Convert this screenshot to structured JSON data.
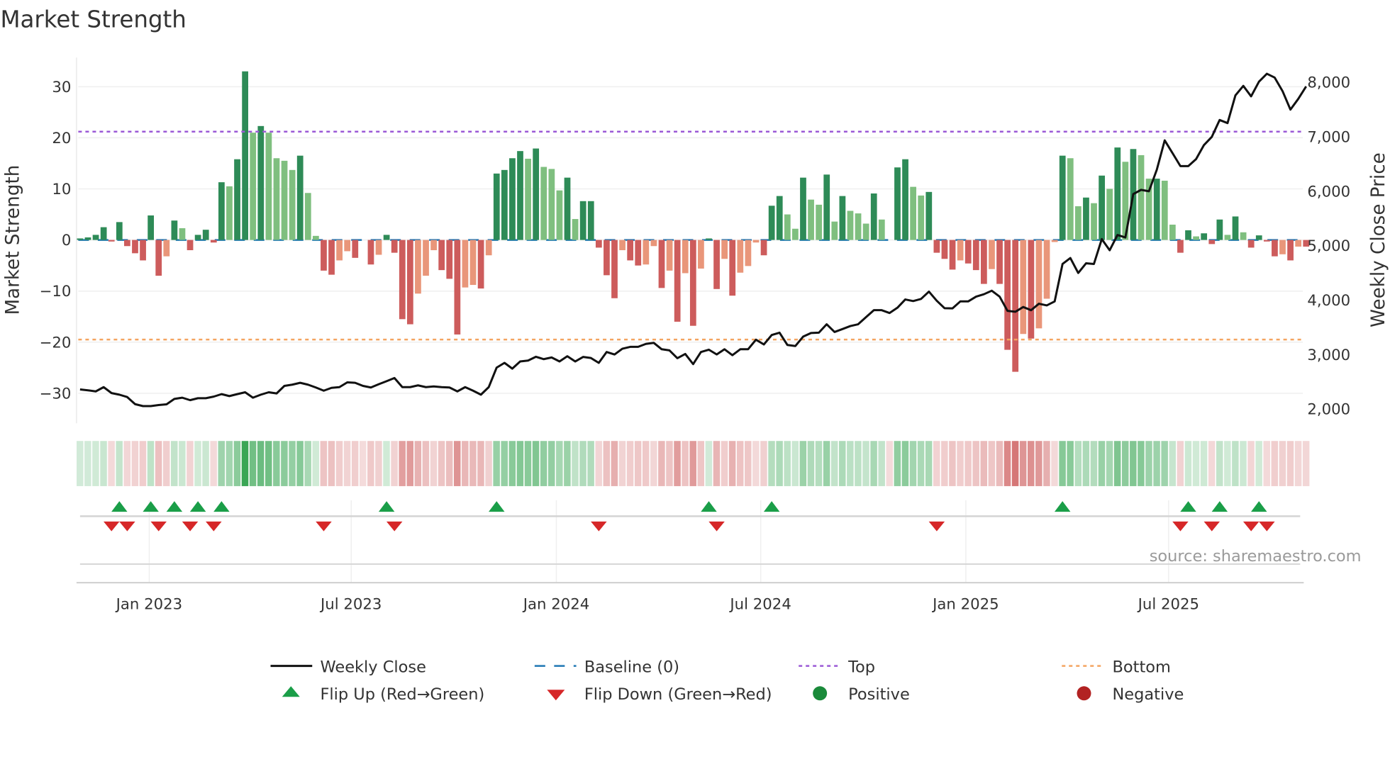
{
  "title": "Market Strength",
  "source": "source: sharemaestro.com",
  "colors": {
    "pos_strong": "#2e8b57",
    "pos_weak": "#7fbf7f",
    "neg_strong": "#cd5c5c",
    "neg_weak": "#e9967a",
    "baseline": "#1f77b4",
    "top": "#9b59d6",
    "bottom": "#f4a460",
    "price": "#111111",
    "flip_up": "#1a9e48",
    "flip_down": "#d62728",
    "strip_pos": "#3aa655",
    "strip_neg": "#cd5c5c"
  },
  "legend": [
    {
      "label": "Weekly Close",
      "kind": "line"
    },
    {
      "label": "Baseline (0)",
      "kind": "dash"
    },
    {
      "label": "Top",
      "kind": "dot-top"
    },
    {
      "label": "Bottom",
      "kind": "dot-bottom"
    },
    {
      "label": "Flip Up (Red→Green)",
      "kind": "tri-up"
    },
    {
      "label": "Flip Down (Green→Red)",
      "kind": "tri-down"
    },
    {
      "label": "Positive",
      "kind": "circle-pos"
    },
    {
      "label": "Negative",
      "kind": "circle-neg"
    }
  ],
  "chart_data": {
    "type": "bar",
    "title": "Market Strength",
    "ylabel": "Market Strength",
    "y2label": "Weekly Close Price",
    "ylim": [
      -36,
      36
    ],
    "y2lim": [
      1700,
      8700
    ],
    "yticks": [
      30,
      20,
      10,
      0,
      -10,
      -20,
      -30
    ],
    "ytick_labels": [
      "30",
      "20",
      "10",
      "0",
      "−10",
      "−20",
      "−30"
    ],
    "y2ticks": [
      8000,
      7000,
      6000,
      5000,
      4000,
      3000,
      2000
    ],
    "y2tick_labels": [
      "8,000",
      "7,000",
      "6,000",
      "5,000",
      "4,000",
      "3,000",
      "2,000"
    ],
    "x_unit": "week index",
    "xticks": [
      8.8,
      34.5,
      60.6,
      86.6,
      112.7,
      138.5
    ],
    "xtick_labels": [
      "Jan 2023",
      "Jul 2023",
      "Jan 2024",
      "Jul 2024",
      "Jan 2025",
      "Jul 2025"
    ],
    "top_level": 21.2,
    "bottom_level": -19.5,
    "baseline": 0,
    "grid": true,
    "legend_position": "bottom",
    "strength": [
      0.3,
      0.5,
      1,
      2.5,
      -0.3,
      3.5,
      -1.2,
      -2.6,
      -4,
      4.8,
      -7,
      -3.2,
      3.8,
      2.3,
      -2,
      1,
      2,
      -0.5,
      11.3,
      10.5,
      15.8,
      33,
      21,
      22.3,
      21,
      16,
      15.5,
      13.7,
      16.5,
      9.2,
      0.8,
      -6,
      -6.8,
      -4,
      -2.2,
      -3.5,
      0,
      -4.8,
      -2.9,
      1,
      -2.5,
      -15.5,
      -16.5,
      -10.5,
      -7,
      -2,
      -5.9,
      -7.6,
      -18.5,
      -9.3,
      -8.8,
      -9.5,
      -3,
      13,
      13.7,
      16,
      17.4,
      15.9,
      17.9,
      14.3,
      13.9,
      9.7,
      12.2,
      4.1,
      7.6,
      7.6,
      -1.5,
      -6.9,
      -11.4,
      -2,
      -4,
      -5,
      -4.8,
      -1.2,
      -9.4,
      -6,
      -16,
      -6.5,
      -16.8,
      -5.6,
      0.3,
      -9.6,
      -3.7,
      -10.9,
      -6.4,
      -5.1,
      -0.5,
      -3,
      6.7,
      8.6,
      5,
      2.2,
      12.2,
      7.9,
      6.9,
      12.8,
      3.6,
      8.6,
      5.7,
      5.2,
      3.2,
      9.1,
      4,
      0,
      14.2,
      15.8,
      10.4,
      8.7,
      9.4,
      -2.5,
      -3.7,
      -5.8,
      -4,
      -4.6,
      -5.9,
      -8.6,
      -5.7,
      -8.6,
      -21.5,
      -25.8,
      -18.4,
      -19.3,
      -17.3,
      -11.5,
      -0.4,
      16.5,
      16,
      6.6,
      8.3,
      7.2,
      12.6,
      10,
      18.1,
      15.3,
      17.8,
      16.6,
      12,
      12,
      11.6,
      3,
      -2.5,
      1.9,
      0.7,
      1.3,
      -0.8,
      4,
      1,
      4.6,
      1.5,
      -1.5,
      0.9,
      -0.3,
      -3.2,
      -2.8,
      -4,
      -1.3,
      -1.3
    ],
    "weekly_close": [
      2361,
      2345,
      2326,
      2404,
      2295,
      2265,
      2221,
      2091,
      2056,
      2056,
      2074,
      2087,
      2187,
      2209,
      2165,
      2200,
      2200,
      2230,
      2274,
      2239,
      2274,
      2309,
      2209,
      2265,
      2309,
      2287,
      2426,
      2448,
      2483,
      2448,
      2396,
      2339,
      2391,
      2404,
      2491,
      2483,
      2426,
      2396,
      2457,
      2513,
      2570,
      2404,
      2404,
      2435,
      2404,
      2417,
      2404,
      2396,
      2326,
      2404,
      2339,
      2265,
      2404,
      2761,
      2848,
      2743,
      2874,
      2891,
      2961,
      2917,
      2948,
      2874,
      2970,
      2874,
      2957,
      2939,
      2848,
      3048,
      3004,
      3109,
      3143,
      3143,
      3196,
      3217,
      3100,
      3078,
      2935,
      3013,
      2826,
      3048,
      3091,
      3004,
      3100,
      2991,
      3100,
      3100,
      3274,
      3187,
      3361,
      3404,
      3178,
      3157,
      3330,
      3396,
      3404,
      3557,
      3417,
      3470,
      3526,
      3557,
      3687,
      3817,
      3817,
      3765,
      3861,
      4013,
      3983,
      4022,
      4157,
      3991,
      3852,
      3848,
      3978,
      3978,
      4065,
      4109,
      4174,
      4065,
      3804,
      3787,
      3874,
      3817,
      3935,
      3904,
      3978,
      4665,
      4774,
      4500,
      4678,
      4665,
      5122,
      4917,
      5196,
      5152,
      5948,
      6026,
      6000,
      6396,
      6935,
      6700,
      6461,
      6461,
      6591,
      6848,
      7000,
      7309,
      7252,
      7761,
      7935,
      7743,
      8013,
      8157,
      8087,
      7839,
      7500,
      7696,
      7926
    ],
    "flip_up_weeks": [
      5,
      9,
      12,
      15,
      18,
      39,
      53,
      80,
      88,
      125,
      141,
      145,
      150
    ],
    "flip_down_weeks": [
      4,
      6,
      10,
      14,
      17,
      31,
      40,
      66,
      81,
      109,
      140,
      144,
      149,
      151
    ]
  }
}
